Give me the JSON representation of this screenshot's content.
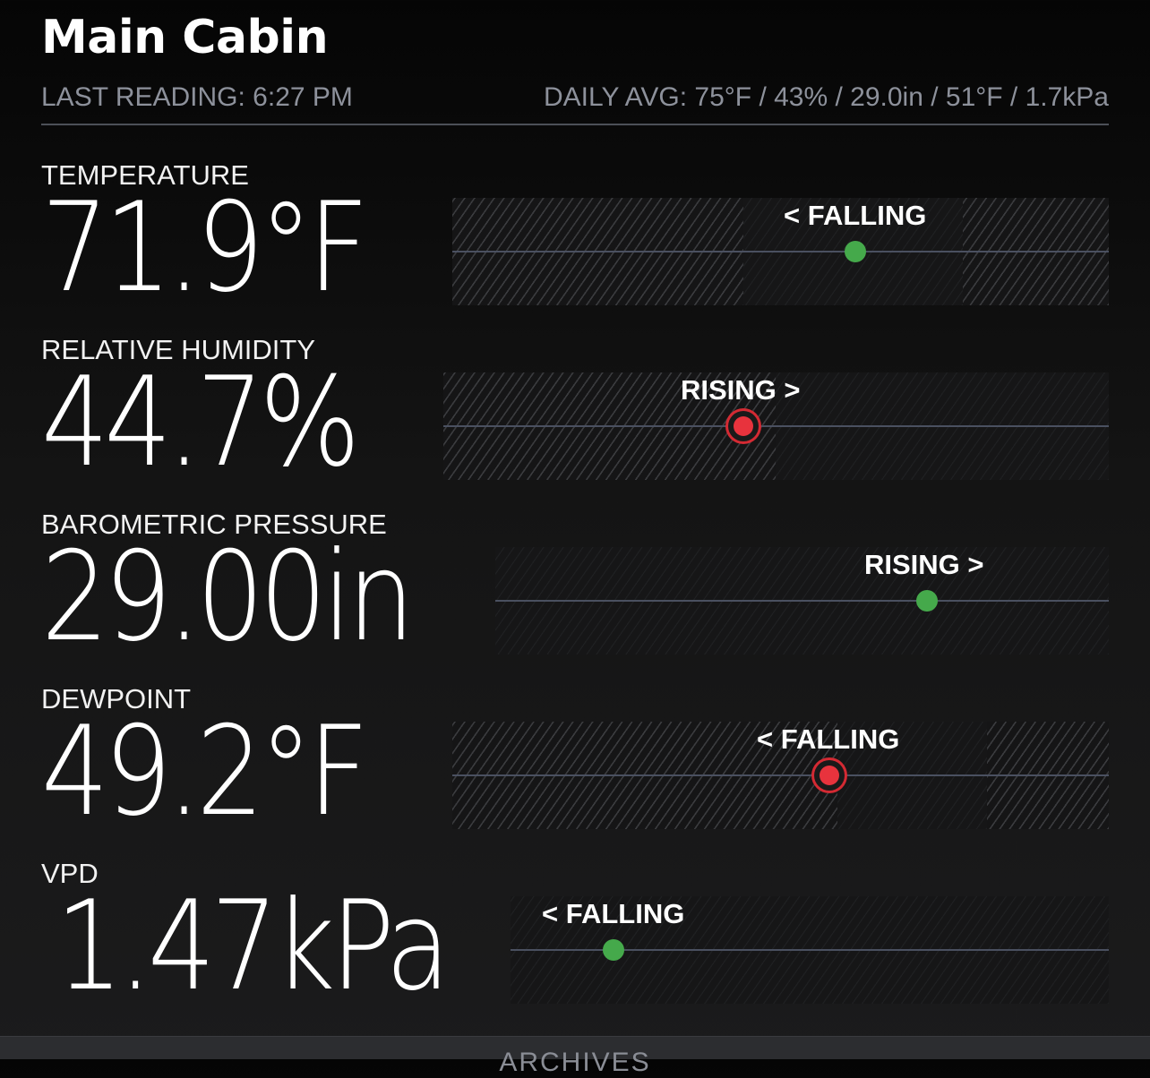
{
  "header": {
    "title": "Main Cabin",
    "last_reading": "LAST READING: 6:27 PM",
    "daily_avg": "DAILY AVG: 75°F / 43% / 29.0in / 51°F / 1.7kPa"
  },
  "colors": {
    "normal_dot": "#45a94b",
    "alert_dot": "#e8333d",
    "background": "#111111"
  },
  "metrics": [
    {
      "label": "TEMPERATURE",
      "value": "71.9°F",
      "trend": "< FALLING",
      "status": "normal"
    },
    {
      "label": "RELATIVE HUMIDITY",
      "value": "44.7%",
      "trend": "RISING >",
      "status": "alert"
    },
    {
      "label": "BAROMETRIC PRESSURE",
      "value": "29.00in",
      "trend": "RISING >",
      "status": "normal"
    },
    {
      "label": "DEWPOINT",
      "value": "49.2°F",
      "trend": "< FALLING",
      "status": "alert"
    },
    {
      "label": "VPD",
      "value": "1.47kPa",
      "trend": "< FALLING",
      "status": "normal"
    }
  ],
  "footer": {
    "label": "ARCHIVES"
  }
}
